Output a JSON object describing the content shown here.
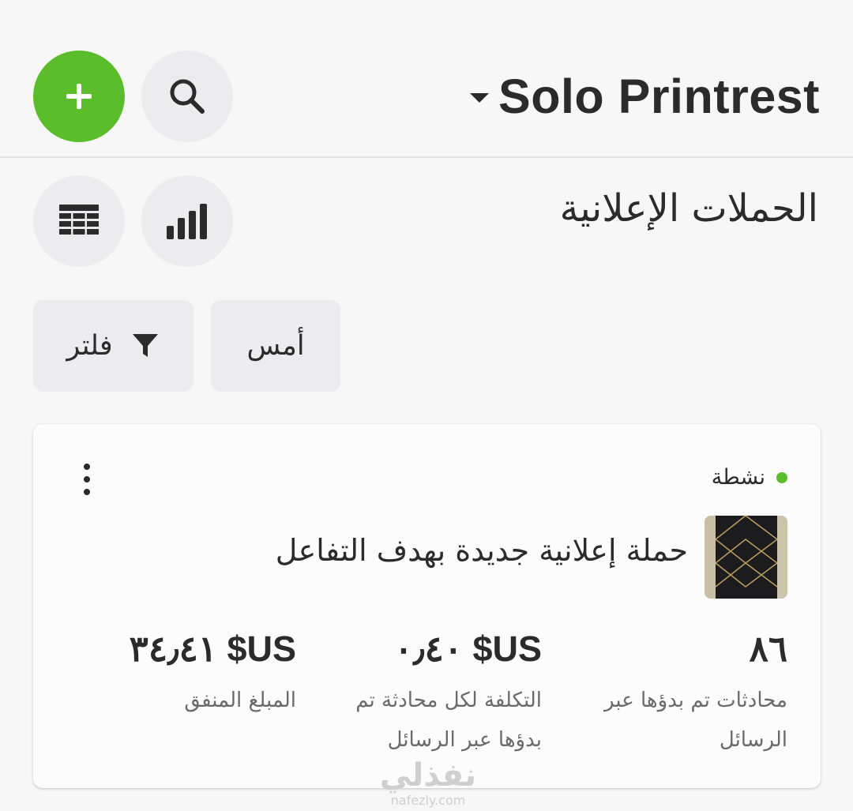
{
  "header": {
    "account_name": "Solo Printrest",
    "add_icon": "plus-icon",
    "search_icon": "search-icon"
  },
  "page": {
    "title": "الحملات الإعلانية"
  },
  "toolbar": {
    "grid_icon": "table-grid-icon",
    "chart_icon": "bar-chart-icon"
  },
  "filters": {
    "filter_label": "فلتر",
    "date_label": "أمس"
  },
  "campaign": {
    "status": "نشطة",
    "name": "حملة إعلانية جديدة بهدف التفاعل",
    "metrics": [
      {
        "value": "٨٦",
        "label": "محادثات تم بدؤها عبر الرسائل"
      },
      {
        "value": "US$ ٠٫٤٠",
        "label": "التكلفة لكل محادثة تم بدؤها عبر الرسائل"
      },
      {
        "value": "US$ ٣٤٫٤١",
        "label": "المبلغ المنفق"
      }
    ]
  },
  "watermark": {
    "arabic": "نفذلي",
    "latin": "nafezly.com"
  },
  "colors": {
    "accent_green": "#5bbd2b",
    "button_bg": "#ececee",
    "text": "#2b2b2b"
  }
}
